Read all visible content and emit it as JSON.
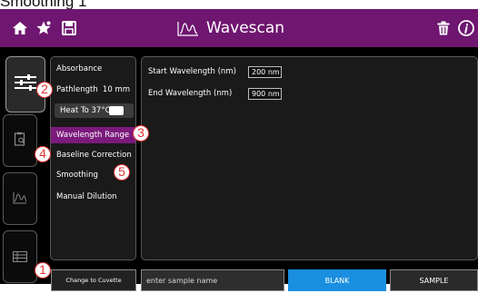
{
  "caption": "Smoothing 1",
  "app": {
    "title": "Wavescan",
    "header_icons": [
      "home-icon",
      "favorite-star-icon",
      "save-icon",
      "wave-logo-icon",
      "trash-icon",
      "info-icon"
    ]
  },
  "side_tabs": [
    {
      "name": "settings-sliders-icon",
      "active": true
    },
    {
      "name": "results-clipboard-icon",
      "active": false
    },
    {
      "name": "graph-icon",
      "active": false
    },
    {
      "name": "table-icon",
      "active": false
    }
  ],
  "menu": {
    "absorbance": "Absorbance",
    "pathlength_label": "Pathlength",
    "pathlength_value": "10 mm",
    "heat_label": "Heat To 37°C",
    "wavelength_range": "Wavelength Range",
    "baseline_correction": "Baseline Correction",
    "smoothing": "Smoothing",
    "manual_dilution": "Manual Dilution"
  },
  "fields": {
    "start_label": "Start Wavelength (nm)",
    "start_value": "200  nm",
    "end_label": "End Wavelength (nm)",
    "end_value": "900  nm"
  },
  "bottom": {
    "cuvette_button": "Change to Cuvette",
    "sample_placeholder": "enter sample name",
    "blank_button": "BLANK",
    "sample_button": "SAMPLE"
  },
  "callouts": [
    "1",
    "2",
    "3",
    "4",
    "5"
  ],
  "colors": {
    "header": "#6f1670",
    "active_item": "#7b1a7c",
    "blank_button": "#1a8fe0",
    "callout": "#e53030"
  }
}
